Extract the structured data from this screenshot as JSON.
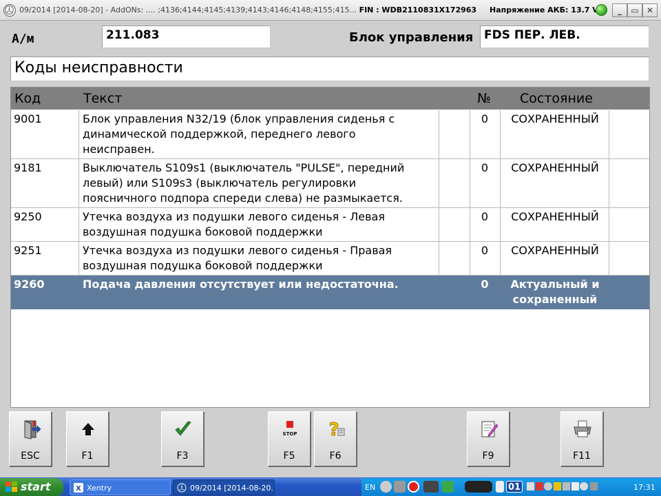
{
  "window": {
    "title_prefix": "09/2014 [2014-08-20] - AddONs:  .... ;4136;4144;4145;4139;4143;4146;4148;4155;415...",
    "fin_label": "FIN : WDB2110831X172963",
    "battery_label": "Напряжение АКБ: 13.7 V",
    "minimize": "_",
    "restore": "▭",
    "close": "✕"
  },
  "header": {
    "model_label": "А/м",
    "model_value": "211.083",
    "control_unit_label": "Блок управления",
    "control_unit_value": "FDS ПЕР. ЛЕВ.",
    "section_title": "Коды неисправности"
  },
  "table": {
    "columns": {
      "code": "Код",
      "text": "Текст",
      "num": "№",
      "status": "Состояние"
    },
    "rows": [
      {
        "code": "9001",
        "lines": [
          "Блок управления N32/19 (блок управления сиденья с",
          "динамической поддержкой, переднего левого",
          "неисправен."
        ],
        "num": "0",
        "status": [
          "СОХРАНЕННЫЙ"
        ]
      },
      {
        "code": "9181",
        "lines": [
          "Выключатель S109s1 (выключатель \"PULSE\", передний",
          "левый) или S109s3 (выключатель регулировки",
          "поясничного подпора спереди слева) не размыкается."
        ],
        "num": "0",
        "status": [
          "СОХРАНЕННЫЙ"
        ]
      },
      {
        "code": "9250",
        "lines": [
          "Утечка воздуха из подушки левого сиденья - Левая",
          "воздушная подушка боковой поддержки"
        ],
        "num": "0",
        "status": [
          "СОХРАНЕННЫЙ"
        ]
      },
      {
        "code": "9251",
        "lines": [
          "Утечка воздуха из подушки левого сиденья - Правая",
          "воздушная подушка боковой поддержки"
        ],
        "num": "0",
        "status": [
          "СОХРАНЕННЫЙ"
        ]
      },
      {
        "code": "9260",
        "lines": [
          "Подача давления отсутствует или недостаточна."
        ],
        "num": "0",
        "status": [
          "Актуальный и",
          "сохраненный"
        ],
        "selected": true
      }
    ]
  },
  "function_keys": [
    {
      "label": "ESC",
      "icon": "exit-door-icon"
    },
    {
      "label": "F1",
      "icon": "arrow-up-icon"
    },
    {
      "label": "F3",
      "icon": "checkmark-icon"
    },
    {
      "label": "F5",
      "icon": "stop-sign-icon",
      "icon_text": "STOP"
    },
    {
      "label": "F6",
      "icon": "help-question-icon"
    },
    {
      "label": "F9",
      "icon": "edit-notepad-icon"
    },
    {
      "label": "F11",
      "icon": "printer-icon"
    }
  ],
  "taskbar": {
    "start_label": "start",
    "tasks": [
      {
        "label": "Xentry",
        "icon": "xentry-icon"
      },
      {
        "label": "09/2014 [2014-08-20...",
        "icon": "mercedes-star-icon"
      }
    ],
    "language": "EN",
    "tray_counter": "01",
    "clock": "17:31"
  },
  "colors": {
    "header_gray": "#808080",
    "selection_blue": "#5f7b9c",
    "taskbar_blue": "#2458c6",
    "start_green": "#2f8a2d",
    "stop_red": "#e02020",
    "check_green": "#2a8a2a"
  }
}
